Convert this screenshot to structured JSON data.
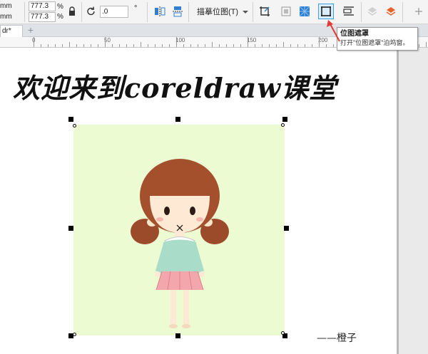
{
  "property_bar": {
    "width_unit": "mm",
    "height_unit": "mm",
    "width_value": "777.3",
    "height_value": "777.3",
    "scale_unit_top": "%",
    "scale_unit_bottom": "%",
    "rotation_value": ".0",
    "rotation_unit": "°",
    "trace_bitmap_label": "描摹位图(T)"
  },
  "tabs": {
    "document_tab": "dr*",
    "new_tab": "+"
  },
  "ruler": {
    "labels": [
      "0",
      "50",
      "100",
      "150",
      "200"
    ]
  },
  "canvas": {
    "headline": "欢迎来到coreldraw课堂",
    "signature": "——橙子"
  },
  "tooltip": {
    "title": "位图遮罩",
    "description": "打开\"位图遮罩\"泊坞窗。"
  },
  "colors": {
    "bitmap_background": "#ecfbd2",
    "accent": "#3c9fe0",
    "arrow": "#e53935"
  }
}
